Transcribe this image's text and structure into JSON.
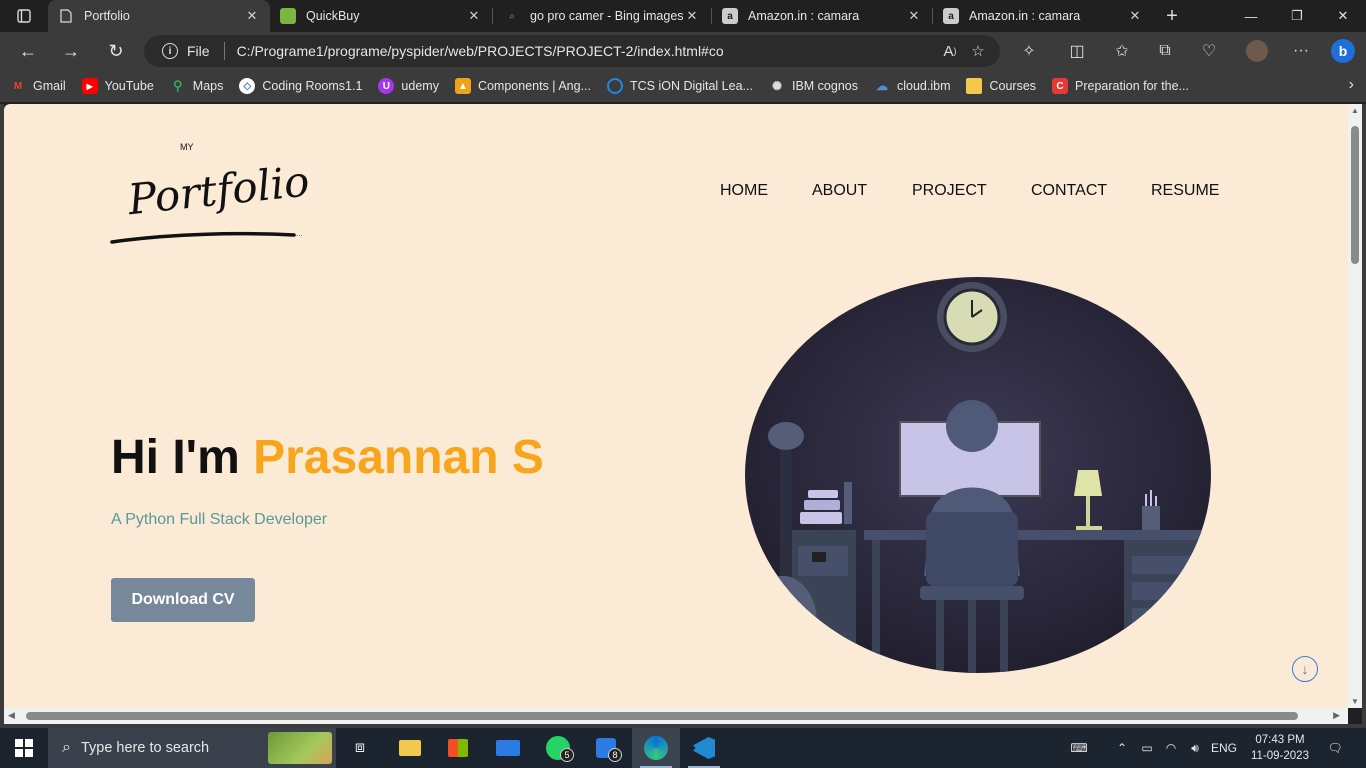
{
  "browser": {
    "tabs": [
      {
        "title": "Portfolio",
        "active": true
      },
      {
        "title": "QuickBuy",
        "active": false
      },
      {
        "title": "go pro camer - Bing images",
        "active": false
      },
      {
        "title": "Amazon.in : camara",
        "active": false
      },
      {
        "title": "Amazon.in : camara",
        "active": false
      }
    ],
    "address": {
      "scheme_label": "File",
      "url": "C:/Programe1/programe/pyspider/web/PROJECTS/PROJECT-2/index.html#co"
    },
    "bookmarks": [
      {
        "label": "Gmail",
        "icon": "gmail-icon",
        "color": "#ea4335"
      },
      {
        "label": "YouTube",
        "icon": "youtube-icon",
        "color": "#ff0000"
      },
      {
        "label": "Maps",
        "icon": "maps-icon",
        "color": "#34a853"
      },
      {
        "label": "Coding Rooms1.1",
        "icon": "coding-rooms-icon",
        "color": "#3d7bd9"
      },
      {
        "label": "udemy",
        "icon": "udemy-icon",
        "color": "#a435f0"
      },
      {
        "label": "Components | Ang...",
        "icon": "angular-icon",
        "color": "#f0a21a"
      },
      {
        "label": "TCS iON Digital Lea...",
        "icon": "tcs-icon",
        "color": "#1e88e5"
      },
      {
        "label": "IBM cognos",
        "icon": "ibm-icon",
        "color": "#dddddd"
      },
      {
        "label": "cloud.ibm",
        "icon": "cloud-icon",
        "color": "#4a90d9"
      },
      {
        "label": "Courses",
        "icon": "folder-icon",
        "color": "#f2c94c"
      },
      {
        "label": "Preparation for the...",
        "icon": "coursera-icon",
        "color": "#e53935"
      }
    ]
  },
  "page": {
    "logo": {
      "small": "MY",
      "script": "Portfolio"
    },
    "nav": [
      "HOME",
      "ABOUT",
      "PROJECT",
      "CONTACT",
      "RESUME"
    ],
    "hero": {
      "greeting": "Hi I'm ",
      "name": "Prasannan S",
      "subtitle": "A Python Full Stack Developer",
      "cta": "Download CV"
    },
    "colors": {
      "background": "#fbead6",
      "accent": "#f6a51c",
      "subtitle": "#5a9a96",
      "button": "#77889b"
    }
  },
  "taskbar": {
    "search_placeholder": "Type here to search",
    "apps": [
      {
        "name": "task-view",
        "badge": ""
      },
      {
        "name": "file-explorer",
        "badge": ""
      },
      {
        "name": "microsoft-store",
        "badge": ""
      },
      {
        "name": "mail",
        "badge": ""
      },
      {
        "name": "whatsapp",
        "badge": "5"
      },
      {
        "name": "app-8",
        "badge": "8"
      },
      {
        "name": "edge",
        "badge": ""
      },
      {
        "name": "vscode",
        "badge": ""
      }
    ],
    "language": "ENG",
    "time": "07:43 PM",
    "date": "11-09-2023"
  }
}
